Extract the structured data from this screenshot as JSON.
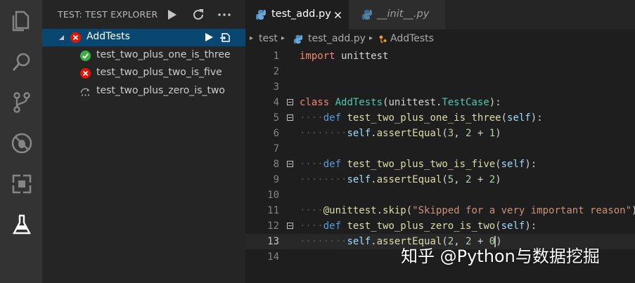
{
  "activity_bar": {
    "icons": [
      "files-icon",
      "search-icon",
      "source-control-icon",
      "debug-icon",
      "extensions-icon",
      "test-flask-icon"
    ]
  },
  "sidebar": {
    "title": "TEST: TEST EXPLORER",
    "tree": {
      "root": {
        "label": "AddTests",
        "status": "failed"
      },
      "children": [
        {
          "label": "test_two_plus_one_is_three",
          "status": "passed"
        },
        {
          "label": "test_two_plus_two_is_five",
          "status": "failed"
        },
        {
          "label": "test_two_plus_zero_is_two",
          "status": "skipped"
        }
      ]
    }
  },
  "tabs": [
    {
      "label": "test_add.py",
      "active": true
    },
    {
      "label": "__init__.py",
      "active": false
    }
  ],
  "breadcrumb": {
    "folder": "test",
    "file": "test_add.py",
    "symbol": "AddTests"
  },
  "code": {
    "lines": [
      {
        "n": "1",
        "text": "import unittest"
      },
      {
        "n": "2",
        "text": ""
      },
      {
        "n": "3",
        "text": ""
      },
      {
        "n": "4",
        "text": "class AddTests(unittest.TestCase):"
      },
      {
        "n": "5",
        "text": "    def test_two_plus_one_is_three(self):"
      },
      {
        "n": "6",
        "text": "        self.assertEqual(3, 2 + 1)"
      },
      {
        "n": "7",
        "text": ""
      },
      {
        "n": "8",
        "text": "    def test_two_plus_two_is_five(self):"
      },
      {
        "n": "9",
        "text": "        self.assertEqual(5, 2 + 2)"
      },
      {
        "n": "10",
        "text": ""
      },
      {
        "n": "11",
        "text": "    @unittest.skip(\"Skipped for a very important reason\")"
      },
      {
        "n": "12",
        "text": "    def test_two_plus_zero_is_two(self):"
      },
      {
        "n": "13",
        "text": "        self.assertEqual(2, 2 + 0)"
      },
      {
        "n": "14",
        "text": ""
      }
    ],
    "current_line": "13"
  },
  "watermark": "知乎 @Python与数据挖掘",
  "colors": {
    "accent_selected": "#094771",
    "passed": "#3bb143",
    "failed": "#e51400",
    "keyword": "#f48771"
  }
}
